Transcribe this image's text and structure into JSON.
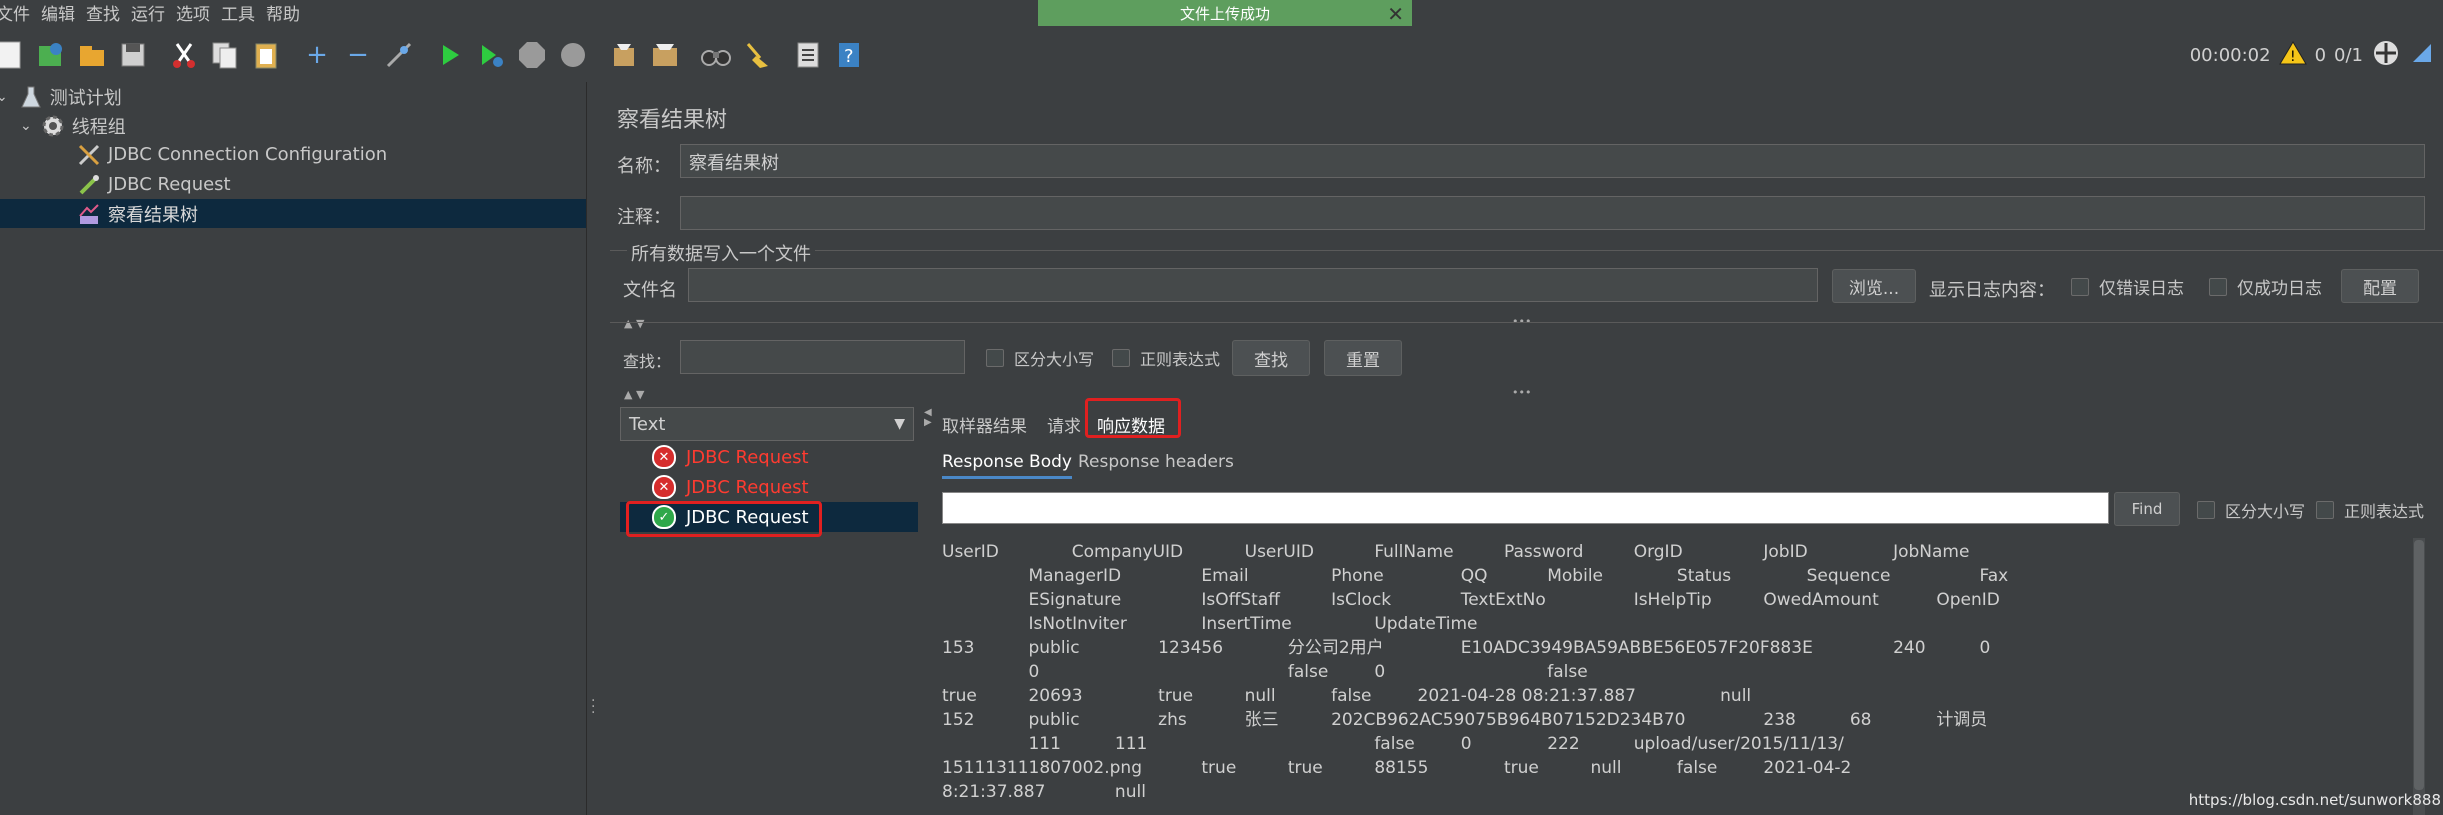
{
  "menu": [
    "文件",
    "编辑",
    "查找",
    "运行",
    "选项",
    "工具",
    "帮助"
  ],
  "toast": {
    "text": "文件上传成功",
    "close": "✕"
  },
  "status": {
    "timer": "00:00:02",
    "warn_count": "0",
    "threads": "0/1"
  },
  "tree": {
    "items": [
      {
        "label": "测试计划",
        "icon": "flask-icon"
      },
      {
        "label": "线程组",
        "icon": "gear-icon"
      },
      {
        "label": "JDBC Connection Configuration",
        "icon": "tools-icon"
      },
      {
        "label": "JDBC Request",
        "icon": "pipette-icon"
      },
      {
        "label": "察看结果树",
        "icon": "chart-icon"
      }
    ]
  },
  "panel": {
    "title": "察看结果树",
    "name_label": "名称：",
    "name_value": "察看结果树",
    "comment_label": "注释：",
    "comment_value": "",
    "file_section": "所有数据写入一个文件",
    "filename_label": "文件名",
    "filename_value": "",
    "browse_btn": "浏览...",
    "log_label": "显示日志内容：",
    "errors_only": "仅错误日志",
    "success_only": "仅成功日志",
    "config_btn": "配置",
    "search_label": "查找：",
    "search_value": "",
    "case_sensitive": "区分大小写",
    "regex": "正则表达式",
    "find_btn": "查找",
    "reset_btn": "重置"
  },
  "renderer": {
    "selected": "Text"
  },
  "results": [
    {
      "label": "JDBC Request",
      "status": "fail"
    },
    {
      "label": "JDBC Request",
      "status": "fail"
    },
    {
      "label": "JDBC Request",
      "status": "ok"
    }
  ],
  "result_tabs": [
    "取样器结果",
    "请求",
    "响应数据"
  ],
  "response_tabs": [
    "Response Body",
    "Response headers"
  ],
  "find": {
    "button": "Find",
    "case": "区分大小写",
    "regex": "正则表达式",
    "value": ""
  },
  "response_body": [
    "UserID\t\tCompanyUID\t\tUserUID\t\tFullName\t\tPassword\t\tOrgID\t\tJobID\t\tJobName",
    "\t\tManagerID\t\tEmail\t\tPhone\t\tQQ\t\tMobile\t\tStatus\t\tSequence\t\tFax",
    "\t\tESignature\t\tIsOffStaff\t\tIsClock\t\tTextExtNo\t\tIsHelpTip\t\tOwedAmount\t\tOpenID",
    "\t\tIsNotInviter\t\tInsertTime\t\tUpdateTime",
    "153\t\tpublic\t\t123456\t\t分公司2用户\t\tE10ADC3949BA59ABBE56E057F20F883E\t\t240\t\t0",
    "\t\t0\t\t\t\t\t\tfalse\t\t0\t\t\t\tfalse",
    "true\t\t20693\t\ttrue\t\tnull\t\tfalse\t\t2021-04-28 08:21:37.887\t\tnull",
    "152\t\tpublic\t\tzhs\t\t张三\t\t202CB962AC59075B964B07152D234B70\t\t238\t\t68\t\t计调员",
    "\t\t111\t\t111\t\t\t\t\t\tfalse\t\t0\t\t222\t\tupload/user/2015/11/13/",
    "151113111807002.png\t\ttrue\t\ttrue\t\t88155\t\ttrue\t\tnull\t\tfalse\t\t2021-04-2",
    "8:21:37.887\t\tnull"
  ],
  "watermark": "https://blog.csdn.net/sunwork888",
  "colors": {
    "accent": "#4a88c7",
    "fail": "#ff3b30",
    "highlight": "#e02020",
    "toast": "#5e9e5e"
  }
}
